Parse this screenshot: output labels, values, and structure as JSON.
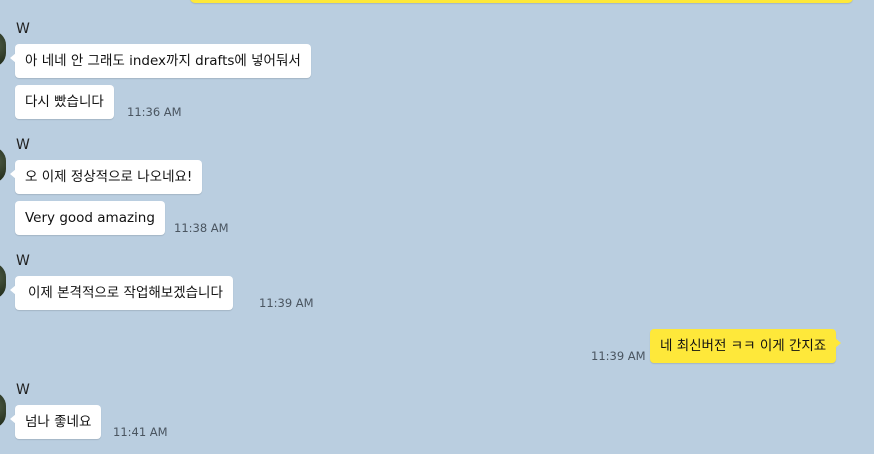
{
  "chat": {
    "messages": [
      {
        "sender": "W",
        "text": "아 네네 안 그래도 index까지 drafts에 넣어둬서"
      },
      {
        "text": "다시 빴습니다",
        "time": "11:36 AM"
      },
      {
        "sender": "W",
        "text": "오 이제 정상적으로 나오네요!"
      },
      {
        "text": "Very good amazing",
        "time": "11:38 AM"
      },
      {
        "sender": "W",
        "text": "이제 본격적으로 작업해보겠습니다",
        "time": "11:39 AM"
      },
      {
        "text": "네 최신버전 ㅋㅋ 이게 간지죠",
        "time": "11:39 AM",
        "outgoing": true
      },
      {
        "sender": "W",
        "text": "넘나 좋네요",
        "time": "11:41 AM"
      }
    ]
  },
  "colors": {
    "background": "#bacee0",
    "incoming_bubble": "#ffffff",
    "outgoing_bubble": "#fee83a"
  }
}
